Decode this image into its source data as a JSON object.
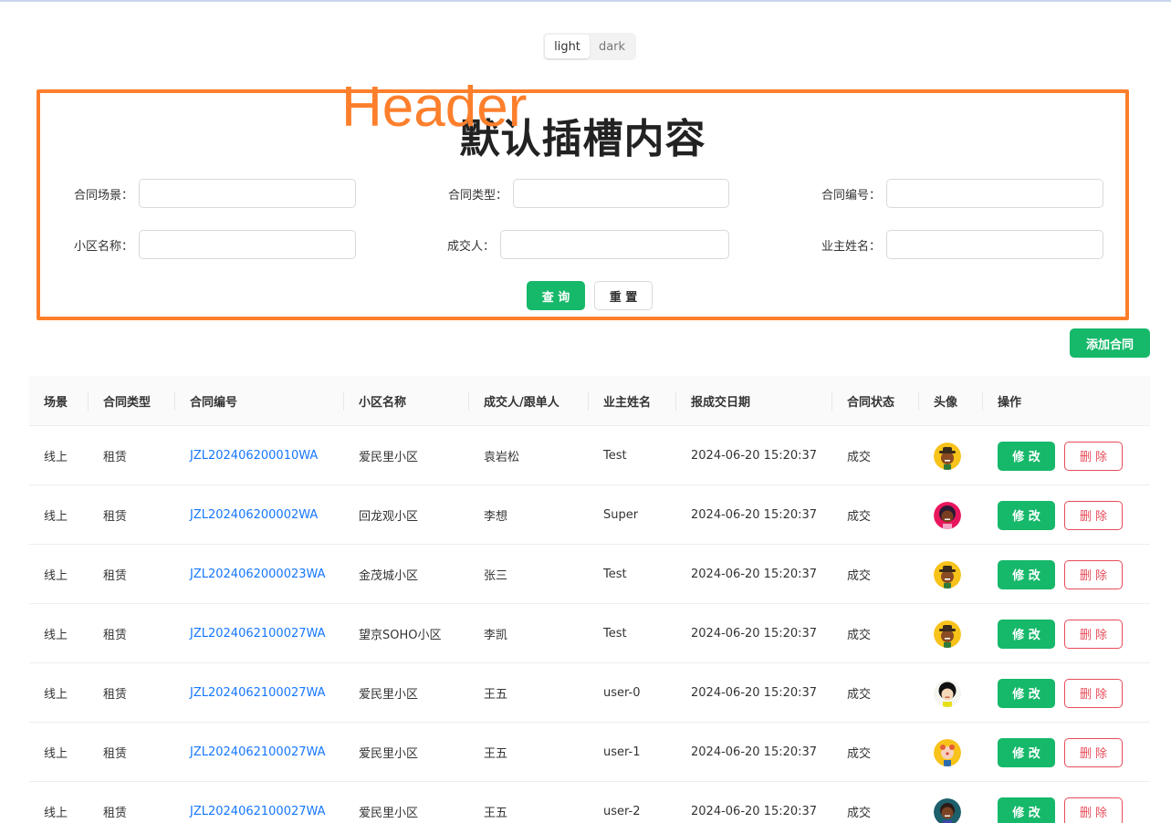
{
  "theme": {
    "light": "light",
    "dark": "dark",
    "active": "light"
  },
  "header": {
    "title": "默认插槽内容",
    "overlay_label": "Header",
    "fields": [
      {
        "label": "合同场景：",
        "value": ""
      },
      {
        "label": "合同类型：",
        "value": ""
      },
      {
        "label": "合同编号：",
        "value": ""
      },
      {
        "label": "小区名称：",
        "value": ""
      },
      {
        "label": "成交人：",
        "value": ""
      },
      {
        "label": "业主姓名：",
        "value": ""
      }
    ],
    "search_label": "查 询",
    "reset_label": "重 置"
  },
  "add_contract_label": "添加合同",
  "table": {
    "columns": [
      "场景",
      "合同类型",
      "合同编号",
      "小区名称",
      "成交人/跟单人",
      "业主姓名",
      "报成交日期",
      "合同状态",
      "头像",
      "操作"
    ],
    "edit_label": "修 改",
    "delete_label": "删 除",
    "rows": [
      {
        "scene": "线上",
        "type": "租赁",
        "code": "JZL202406200010WA",
        "community": "爱民里小区",
        "agent": "袁岩松",
        "owner": "Test",
        "date": "2024-06-20 15:20:37",
        "status": "成交",
        "avatar": "avatar-cowboy-icon"
      },
      {
        "scene": "线上",
        "type": "租赁",
        "code": "JZL202406200002WA",
        "community": "回龙观小区",
        "agent": "李想",
        "owner": "Super",
        "date": "2024-06-20 15:20:37",
        "status": "成交",
        "avatar": "avatar-girl-icon"
      },
      {
        "scene": "线上",
        "type": "租赁",
        "code": "JZL2024062000023WA",
        "community": "金茂城小区",
        "agent": "张三",
        "owner": "Test",
        "date": "2024-06-20 15:20:37",
        "status": "成交",
        "avatar": "avatar-cowboy-icon"
      },
      {
        "scene": "线上",
        "type": "租赁",
        "code": "JZL2024062100027WA",
        "community": "望京SOHO小区",
        "agent": "李凯",
        "owner": "Test",
        "date": "2024-06-20 15:20:37",
        "status": "成交",
        "avatar": "avatar-cowboy-icon"
      },
      {
        "scene": "线上",
        "type": "租赁",
        "code": "JZL2024062100027WA",
        "community": "爱民里小区",
        "agent": "王五",
        "owner": "user-0",
        "date": "2024-06-20 15:20:37",
        "status": "成交",
        "avatar": "avatar-black-hair-icon"
      },
      {
        "scene": "线上",
        "type": "租赁",
        "code": "JZL2024062100027WA",
        "community": "爱民里小区",
        "agent": "王五",
        "owner": "user-1",
        "date": "2024-06-20 15:20:37",
        "status": "成交",
        "avatar": "avatar-clown-icon"
      },
      {
        "scene": "线上",
        "type": "租赁",
        "code": "JZL2024062100027WA",
        "community": "爱民里小区",
        "agent": "王五",
        "owner": "user-2",
        "date": "2024-06-20 15:20:37",
        "status": "成交",
        "avatar": "avatar-dark-icon"
      }
    ]
  },
  "colors": {
    "primary": "#16b86a",
    "link": "#1677ff",
    "danger": "#e74c5a",
    "header_border": "#fd7f2c"
  }
}
